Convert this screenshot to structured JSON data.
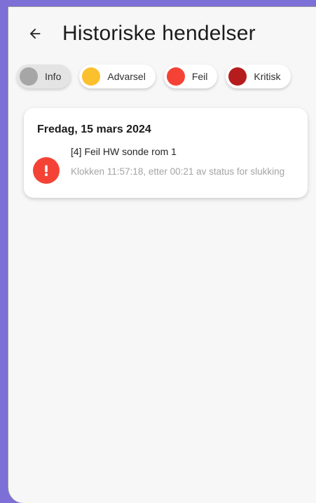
{
  "header": {
    "back_icon": "arrow-left-icon",
    "title": "Historiske hendelser"
  },
  "filters": [
    {
      "label": "Info",
      "color": "#a6a6a6",
      "selected": true
    },
    {
      "label": "Advarsel",
      "color": "#fbc02d",
      "selected": false
    },
    {
      "label": "Feil",
      "color": "#f44336",
      "selected": false
    },
    {
      "label": "Kritisk",
      "color": "#b71c1c",
      "selected": false
    }
  ],
  "events": {
    "date": "Fredag, 15 mars 2024",
    "items": [
      {
        "icon": "error-exclamation-icon",
        "color": "#f44336",
        "title": "[4] Feil HW sonde rom 1",
        "subtitle": "Klokken 11:57:18, etter 00:21 av status for slukking"
      }
    ]
  }
}
